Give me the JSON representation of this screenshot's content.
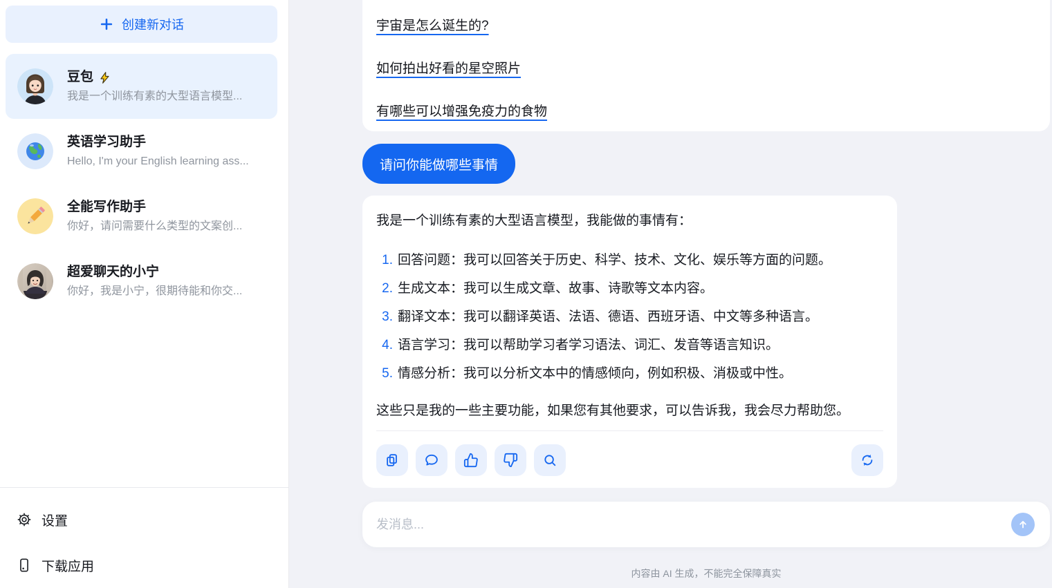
{
  "colors": {
    "accent_blue": "#1667f0",
    "user_bubble_bg": "#1467f0",
    "main_bg": "#f1f2f7",
    "new_chat_bg": "#e9f1fe",
    "selected_chat_bg": "#e9f2fe",
    "action_button_bg": "#e9f0fd",
    "send_button_bg": "#a3c4f8",
    "text_secondary": "#8f959e"
  },
  "sidebar": {
    "new_chat_label": "创建新对话",
    "chats": [
      {
        "title": "豆包",
        "preview": "我是一个训练有素的大型语言模型...",
        "selected": true,
        "avatar": "doubao-girl",
        "badge": "lightning-icon"
      },
      {
        "title": "英语学习助手",
        "preview": "Hello, I'm your English learning ass...",
        "selected": false,
        "avatar": "globe"
      },
      {
        "title": "全能写作助手",
        "preview": "你好，请问需要什么类型的文案创...",
        "selected": false,
        "avatar": "pencil"
      },
      {
        "title": "超爱聊天的小宁",
        "preview": "你好，我是小宁，很期待能和你交...",
        "selected": false,
        "avatar": "woman-photo"
      }
    ],
    "settings_label": "设置",
    "download_label": "下载应用"
  },
  "chat": {
    "suggested_questions": [
      "宇宙是怎么诞生的?",
      "如何拍出好看的星空照片",
      "有哪些可以增强免疫力的食物"
    ],
    "user_message": "请问你能做哪些事情",
    "assistant_reply": {
      "intro": "我是一个训练有素的大型语言模型，我能做的事情有：",
      "list": [
        {
          "num": "1.",
          "text": "回答问题：我可以回答关于历史、科学、技术、文化、娱乐等方面的问题。"
        },
        {
          "num": "2.",
          "text": "生成文本：我可以生成文章、故事、诗歌等文本内容。"
        },
        {
          "num": "3.",
          "text": "翻译文本：我可以翻译英语、法语、德语、西班牙语、中文等多种语言。"
        },
        {
          "num": "4.",
          "text": "语言学习：我可以帮助学习者学习语法、词汇、发音等语言知识。"
        },
        {
          "num": "5.",
          "text": "情感分析：我可以分析文本中的情感倾向，例如积极、消极或中性。"
        }
      ],
      "outro": "这些只是我的一些主要功能，如果您有其他要求，可以告诉我，我会尽力帮助您。"
    },
    "action_icons": [
      "copy-icon",
      "comment-icon",
      "thumbs-up-icon",
      "thumbs-down-icon",
      "search-icon",
      "refresh-icon"
    ]
  },
  "composer": {
    "placeholder": "发消息...",
    "disclaimer": "内容由 AI 生成，不能完全保障真实"
  }
}
